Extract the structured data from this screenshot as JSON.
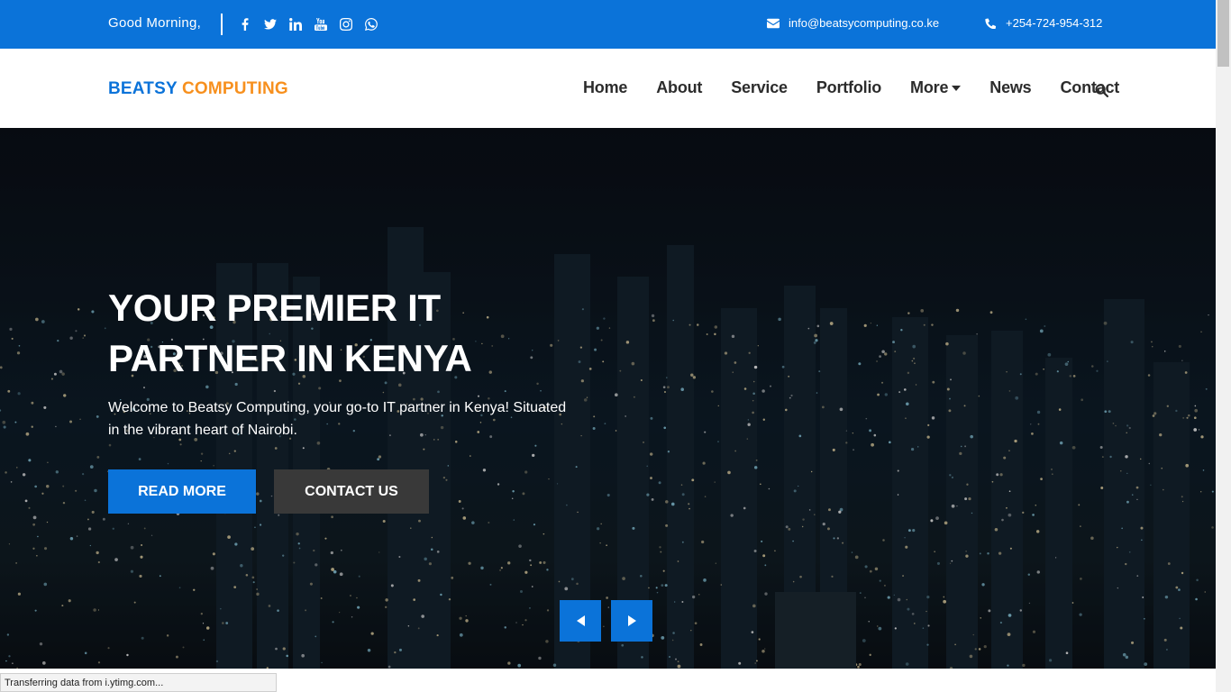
{
  "topbar": {
    "greeting": "Good Morning,",
    "socials": [
      "facebook-icon",
      "twitter-icon",
      "linkedin-icon",
      "youtube-icon",
      "instagram-icon",
      "whatsapp-icon"
    ],
    "email": "info@beatsycomputing.co.ke",
    "phone": "+254-724-954-312",
    "color": "#0b73d9"
  },
  "brand": {
    "part1": "BEATSY",
    "part2": "COMPUTING",
    "color1": "#0b73d9",
    "color2": "#f7901e"
  },
  "nav": {
    "items": [
      "Home",
      "About",
      "Service",
      "Portfolio",
      "More",
      "News",
      "Contact"
    ],
    "search_icon": "search-icon"
  },
  "hero": {
    "title": "YOUR PREMIER IT PARTNER IN KENYA",
    "text": "Welcome to Beatsy Computing, your go-to IT partner in Kenya! Situated in the vibrant heart of Nairobi.",
    "read_more": "READ MORE",
    "contact_us": "CONTACT US",
    "prev_icon": "caret-left-icon",
    "next_icon": "caret-right-icon"
  },
  "status": {
    "text": "Transferring data from i.ytimg.com..."
  }
}
